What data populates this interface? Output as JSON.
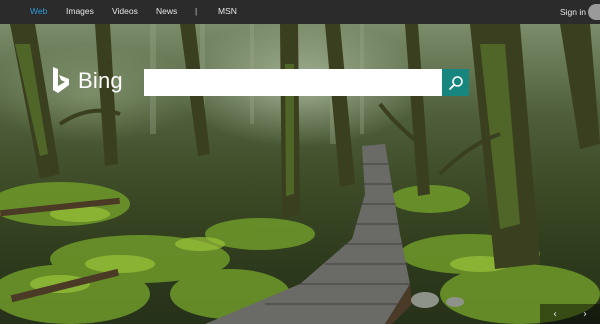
{
  "nav": {
    "items": [
      {
        "label": "Web",
        "active": true
      },
      {
        "label": "Images",
        "active": false
      },
      {
        "label": "Videos",
        "active": false
      },
      {
        "label": "News",
        "active": false
      }
    ],
    "separator": "|",
    "msn": "MSN",
    "sign_in": "Sign in"
  },
  "logo": {
    "text": "Bing",
    "icon": "bing-logo-icon"
  },
  "search": {
    "value": "",
    "placeholder": "",
    "button_icon": "search-icon"
  },
  "carousel": {
    "prev": "‹",
    "next": "›"
  },
  "colors": {
    "topbar": "#2b2b2b",
    "active_nav": "#2f9ad6",
    "search_button": "#17867f"
  }
}
